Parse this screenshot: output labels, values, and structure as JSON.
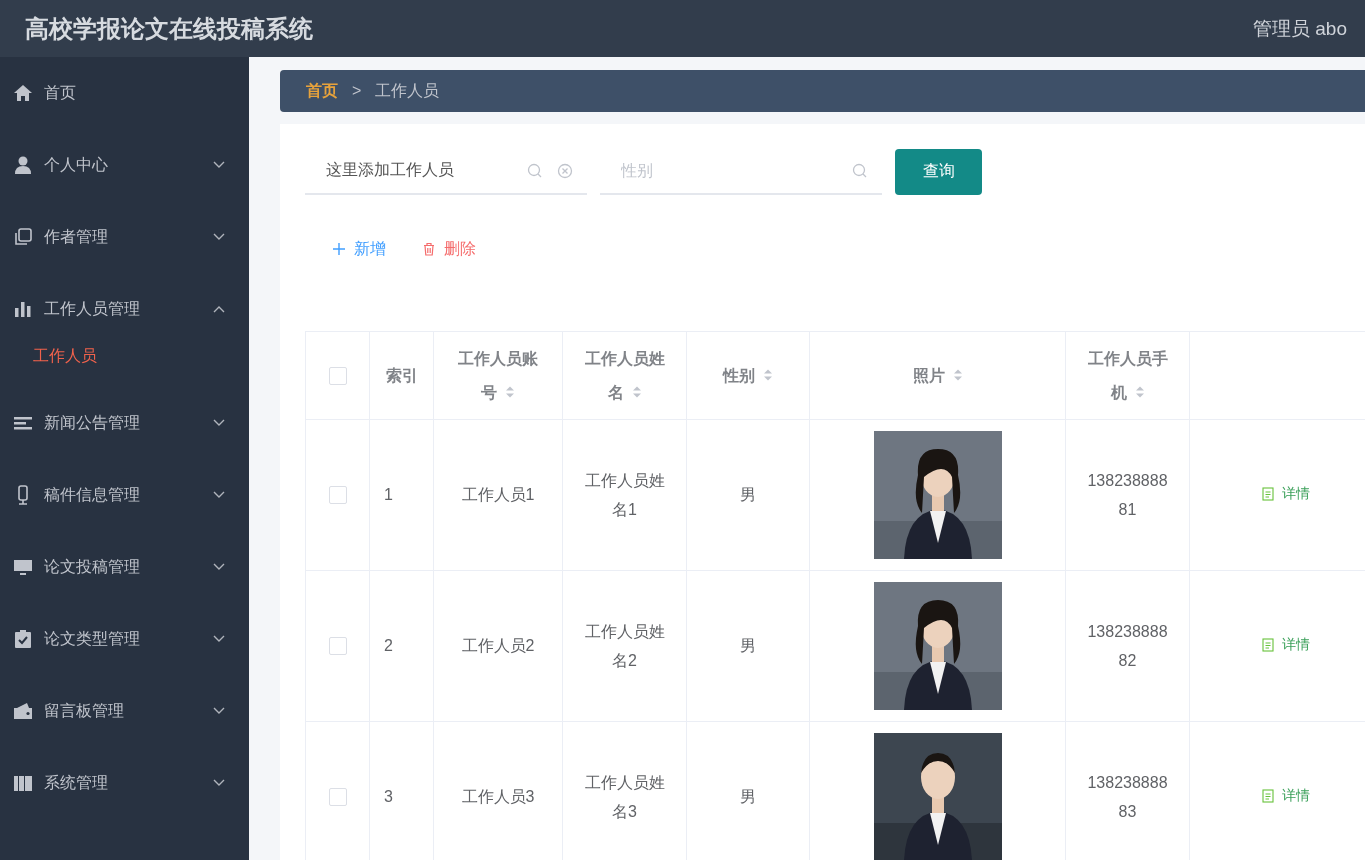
{
  "header": {
    "title": "高校学报论文在线投稿系统",
    "user": "管理员 abo"
  },
  "sidebar": {
    "items": [
      {
        "label": "首页",
        "kind": "link"
      },
      {
        "label": "个人中心",
        "kind": "submenu",
        "expanded": false
      },
      {
        "label": "作者管理",
        "kind": "submenu",
        "expanded": false
      },
      {
        "label": "工作人员管理",
        "kind": "submenu",
        "expanded": true,
        "children": [
          {
            "label": "工作人员",
            "selected": true
          }
        ]
      },
      {
        "label": "新闻公告管理",
        "kind": "submenu",
        "expanded": false
      },
      {
        "label": "稿件信息管理",
        "kind": "submenu",
        "expanded": false
      },
      {
        "label": "论文投稿管理",
        "kind": "submenu",
        "expanded": false
      },
      {
        "label": "论文类型管理",
        "kind": "submenu",
        "expanded": false
      },
      {
        "label": "留言板管理",
        "kind": "submenu",
        "expanded": false
      },
      {
        "label": "系统管理",
        "kind": "submenu",
        "expanded": false
      }
    ]
  },
  "breadcrumb": [
    {
      "label": "首页"
    },
    {
      "label": ">"
    },
    {
      "label": "工作人员"
    }
  ],
  "search": {
    "account": {
      "value": "这里添加工作人员"
    },
    "gender": {
      "placeholder": "性别"
    },
    "button": "查询"
  },
  "actions": [
    {
      "label": "新增",
      "kind": "add"
    },
    {
      "label": "删除",
      "kind": "delete"
    }
  ],
  "table": {
    "select_all_checked": false,
    "columns": [
      {
        "label": "索引",
        "sortable": false
      },
      {
        "label": "工作人员账号",
        "sortable": true
      },
      {
        "label": "工作人员姓名",
        "sortable": true
      },
      {
        "label": "性别",
        "sortable": true
      },
      {
        "label": "照片",
        "sortable": true
      },
      {
        "label": "工作人员手机",
        "sortable": true
      }
    ],
    "rows": [
      {
        "checked": false,
        "index": "1",
        "account": "工作人员1",
        "name": "工作人员姓名1",
        "gender": "男",
        "phone": "13823888881",
        "detail": "详情"
      },
      {
        "checked": false,
        "index": "2",
        "account": "工作人员2",
        "name": "工作人员姓名2",
        "gender": "男",
        "phone": "13823888882",
        "detail": "详情"
      },
      {
        "checked": false,
        "index": "3",
        "account": "工作人员3",
        "name": "工作人员姓名3",
        "gender": "男",
        "phone": "13823888883",
        "detail": "详情"
      }
    ]
  }
}
